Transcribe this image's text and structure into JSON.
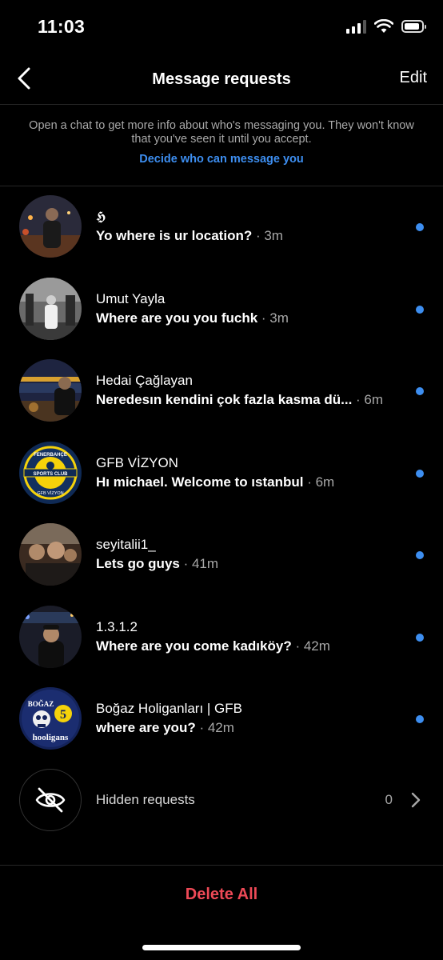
{
  "status_bar": {
    "time": "11:03"
  },
  "header": {
    "title": "Message requests",
    "edit_label": "Edit"
  },
  "info": {
    "text": "Open a chat to get more info about who's messaging you. They won't know that you've seen it until you accept.",
    "link": "Decide who can message you"
  },
  "requests": [
    {
      "name": "𝕳",
      "message": "Yo where is ur location?",
      "time": "· 3m",
      "unread": true,
      "avatar": "photo-night-street"
    },
    {
      "name": "Umut Yayla",
      "message": "Where are you you fuchk",
      "time": "· 3m",
      "unread": true,
      "avatar": "photo-bw-portrait"
    },
    {
      "name": "Hedai Çağlayan",
      "message": "Neredesın kendini çok fazla kasma dü...",
      "time": "· 6m",
      "unread": true,
      "avatar": "photo-waterfront-night"
    },
    {
      "name": "GFB VİZYON",
      "message": "Hı michael. Welcome to ıstanbul",
      "time": "· 6m",
      "unread": true,
      "avatar": "fenerbahce-badge"
    },
    {
      "name": "seyitalii1_",
      "message": "Lets go guys",
      "time": "· 41m",
      "unread": true,
      "avatar": "photo-group-selfie"
    },
    {
      "name": "1.3.1.2",
      "message": "Where are you come kadıköy?",
      "time": "· 42m",
      "unread": true,
      "avatar": "photo-night-portrait"
    },
    {
      "name": "Boğaz Holiganları | GFB",
      "message": "where are you?",
      "time": "· 42m",
      "unread": true,
      "avatar": "bogaz-hooligans-logo"
    }
  ],
  "avatar_text": {
    "fenerbahce_top": "FENERBAHÇE",
    "fenerbahce_mid": "SPORTS CLUB",
    "fenerbahce_bottom": "GFB VİZYON",
    "bogaz_top": "BOĞAZ",
    "bogaz_bottom": "hooligans"
  },
  "hidden_requests": {
    "label": "Hidden requests",
    "count": "0"
  },
  "footer": {
    "delete_all": "Delete All"
  },
  "colors": {
    "accent": "#3d8ef0",
    "danger": "#ed4956",
    "muted": "#a8a8a8",
    "background": "#000000"
  }
}
